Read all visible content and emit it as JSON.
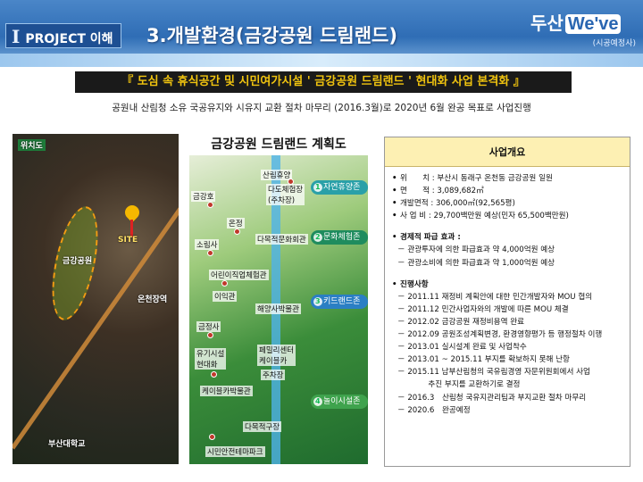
{
  "header": {
    "section_roman": "I",
    "section_label": "PROJECT 이해",
    "title": "3.개발환경(금강공원 드림랜드)",
    "logo_main": "두산",
    "logo_we": "We've",
    "logo_sub": "(시공예정사)"
  },
  "headline": "『 도심 속 휴식공간 및 시민여가시설 ' 금강공원 드림랜드 ' 현대화 사업 본격화 』",
  "intro": "공원내 산림청 소유 국공유지와 시유지 교환 절차 마무리 (2016.3월)로 2020년 6월 완공 목표로 사업진행",
  "map": {
    "label_location": "위치도",
    "label_park": "금강공원",
    "label_site": "SITE",
    "label_station": "온천장역",
    "label_bottom": "부산대학교"
  },
  "plan": {
    "title": "금강공원 드림랜드 계획도",
    "places": [
      "산림휴양",
      "다도체험장\n(주차장)",
      "금강호",
      "온정",
      "소림사",
      "다목적문화회관",
      "어린이직업체험관",
      "이익관",
      "해양사박물관",
      "금정사",
      "유기시설\n현대화",
      "페밀리센터\n케이블카",
      "주차장",
      "케이블카박물관",
      "다목적구장",
      "시민안전테마파크"
    ],
    "zones": [
      {
        "num": "1",
        "label": "자연휴양존"
      },
      {
        "num": "2",
        "label": "문화체험존"
      },
      {
        "num": "3",
        "label": "키드랜드존"
      },
      {
        "num": "4",
        "label": "놀이시설존"
      }
    ]
  },
  "summary": {
    "title": "사업개요",
    "items": [
      "위　　치 : 부산시 동래구 온천동 금강공원 일원",
      "면　　적 : 3,089,682㎡",
      "개발면적 : 306,000㎡(92,565평)",
      "사 업 비 : 29,700백만원 예상(민자 65,500백만원)"
    ],
    "econ_title": "경제적 파급 효과 :",
    "econ": [
      "－ 관광투자에 의한 파급효과 약 4,000억원 예상",
      "－ 관광소비에 의한 파급효과 약 1,000억원 예상"
    ],
    "progress_title": "진행사항",
    "progress": [
      "－ 2011.11 재정비 계획안에 대한 민간개발자와 MOU 협의",
      "－ 2011.12 민간사업자와의 개발에 따른 MOU 체결",
      "－ 2012.02 금강공원 재정비용역 완료",
      "－ 2012.09 공원조성계획변경, 환경영향평가 등 행정절차 이행",
      "－ 2013.01 실시설계 완료 및 사업착수",
      "－ 2013.01 ~ 2015.11 부지를 확보하지 못해 난항",
      "－ 2015.11 남부산림청의 국유림경영 자문위원회에서 사업",
      "　　　　추진 부지를 교환하기로 결정",
      "－ 2016.3　산림청 국유지관리팀과 부지교환 절차 마무리",
      "－ 2020.6　완공예정"
    ]
  }
}
